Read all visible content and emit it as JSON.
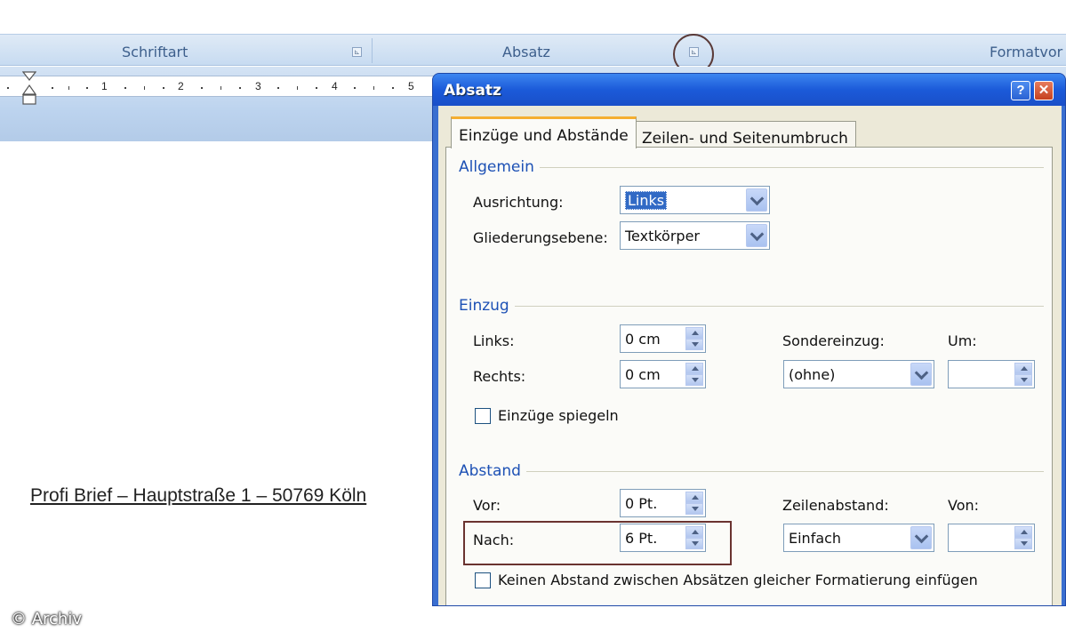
{
  "ribbon": {
    "groups": [
      {
        "label": "Schriftart"
      },
      {
        "label": "Absatz"
      },
      {
        "label": "Formatvor"
      }
    ],
    "launcher_glyph": "⊾",
    "ruler_numbers": [
      "1",
      "2",
      "3",
      "4",
      "5"
    ]
  },
  "document": {
    "text": "Profi Brief – Hauptstraße 1 – 50769 Köln"
  },
  "copyright": "© Archiv",
  "dialog": {
    "title": "Absatz",
    "help_label": "?",
    "close_label": "✕",
    "tabs": [
      {
        "label": "Einzüge und Abstände",
        "active": true
      },
      {
        "label": "Zeilen- und Seitenumbruch",
        "active": false
      }
    ],
    "allgemein": {
      "section": "Allgemein",
      "ausrichtung_label": "Ausrichtung:",
      "ausrichtung_value": "Links",
      "gliederung_label": "Gliederungsebene:",
      "gliederung_value": "Textkörper"
    },
    "einzug": {
      "section": "Einzug",
      "links_label": "Links:",
      "links_value": "0 cm",
      "rechts_label": "Rechts:",
      "rechts_value": "0 cm",
      "sondereinzug_label": "Sondereinzug:",
      "sondereinzug_value": "(ohne)",
      "um_label": "Um:",
      "um_value": "",
      "spiegeln_label": "Einzüge spiegeln",
      "spiegeln_checked": false
    },
    "abstand": {
      "section": "Abstand",
      "vor_label": "Vor:",
      "vor_value": "0 Pt.",
      "nach_label": "Nach:",
      "nach_value": "6 Pt.",
      "zeilenabstand_label": "Zeilenabstand:",
      "zeilenabstand_value": "Einfach",
      "von_label": "Von:",
      "von_value": "",
      "kein_abstand_label": "Keinen Abstand zwischen Absätzen gleicher Formatierung einfügen",
      "kein_abstand_checked": false
    }
  },
  "colors": {
    "titlebar": "#1b5ad9",
    "section_label": "#1d51b5",
    "annotation": "#6a3330"
  }
}
